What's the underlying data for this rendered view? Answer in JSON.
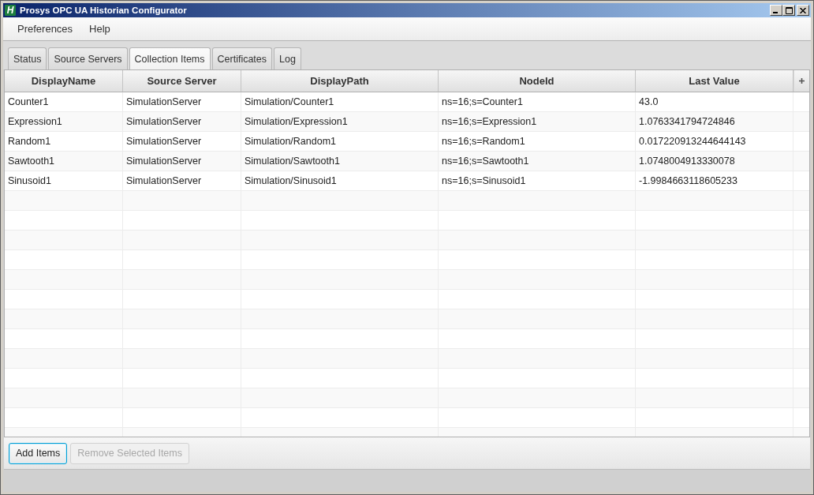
{
  "window": {
    "logo_text": "H",
    "title": "Prosys OPC UA Historian Configurator"
  },
  "menu": [
    {
      "label": "Preferences"
    },
    {
      "label": "Help"
    }
  ],
  "tabs": [
    {
      "label": "Status",
      "selected": false
    },
    {
      "label": "Source Servers",
      "selected": false
    },
    {
      "label": "Collection Items",
      "selected": true
    },
    {
      "label": "Certificates",
      "selected": false
    },
    {
      "label": "Log",
      "selected": false
    }
  ],
  "table": {
    "columns": [
      "DisplayName",
      "Source Server",
      "DisplayPath",
      "NodeId",
      "Last Value"
    ],
    "rows": [
      {
        "selected": false,
        "cells": [
          "Counter1",
          "SimulationServer",
          "Simulation/Counter1",
          "ns=16;s=Counter1",
          "43.0"
        ]
      },
      {
        "selected": false,
        "cells": [
          "Expression1",
          "SimulationServer",
          "Simulation/Expression1",
          "ns=16;s=Expression1",
          "1.0763341794724846"
        ]
      },
      {
        "selected": false,
        "cells": [
          "Random1",
          "SimulationServer",
          "Simulation/Random1",
          "ns=16;s=Random1",
          "0.017220913244644143"
        ]
      },
      {
        "selected": false,
        "cells": [
          "Sawtooth1",
          "SimulationServer",
          "Simulation/Sawtooth1",
          "ns=16;s=Sawtooth1",
          "1.0748004913330078"
        ]
      },
      {
        "selected": false,
        "cells": [
          "Sinusoid1",
          "SimulationServer",
          "Simulation/Sinusoid1",
          "ns=16;s=Sinusoid1",
          "-1.9984663118605233"
        ]
      }
    ]
  },
  "buttons": [
    {
      "label": "Add Items",
      "focused": true,
      "disabled": false
    },
    {
      "label": "Remove Selected Items",
      "focused": false,
      "disabled": true
    }
  ]
}
